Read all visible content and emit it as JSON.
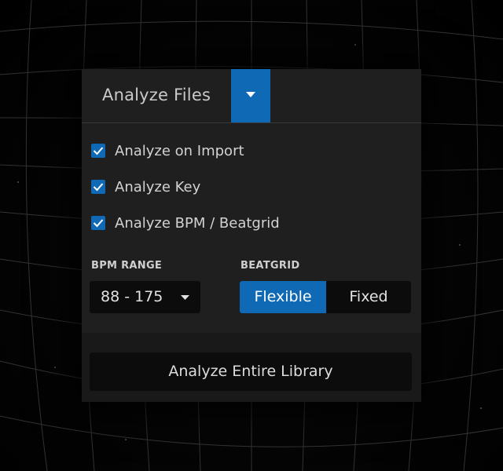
{
  "header": {
    "title": "Analyze Files",
    "dropdown_icon": "caret-down-icon"
  },
  "options": [
    {
      "label": "Analyze on Import",
      "checked": true
    },
    {
      "label": "Analyze Key",
      "checked": true
    },
    {
      "label": "Analyze BPM / Beatgrid",
      "checked": true
    }
  ],
  "bpm_range": {
    "label": "BPM RANGE",
    "value": "88 - 175"
  },
  "beatgrid": {
    "label": "BEATGRID",
    "options": [
      "Flexible",
      "Fixed"
    ],
    "selected": "Flexible"
  },
  "actions": {
    "analyze_library_label": "Analyze Entire Library"
  },
  "colors": {
    "accent": "#0f69b4",
    "panel_bg": "#1f1f1f",
    "control_bg": "#0c0c0c",
    "text": "#d2d2d2"
  }
}
